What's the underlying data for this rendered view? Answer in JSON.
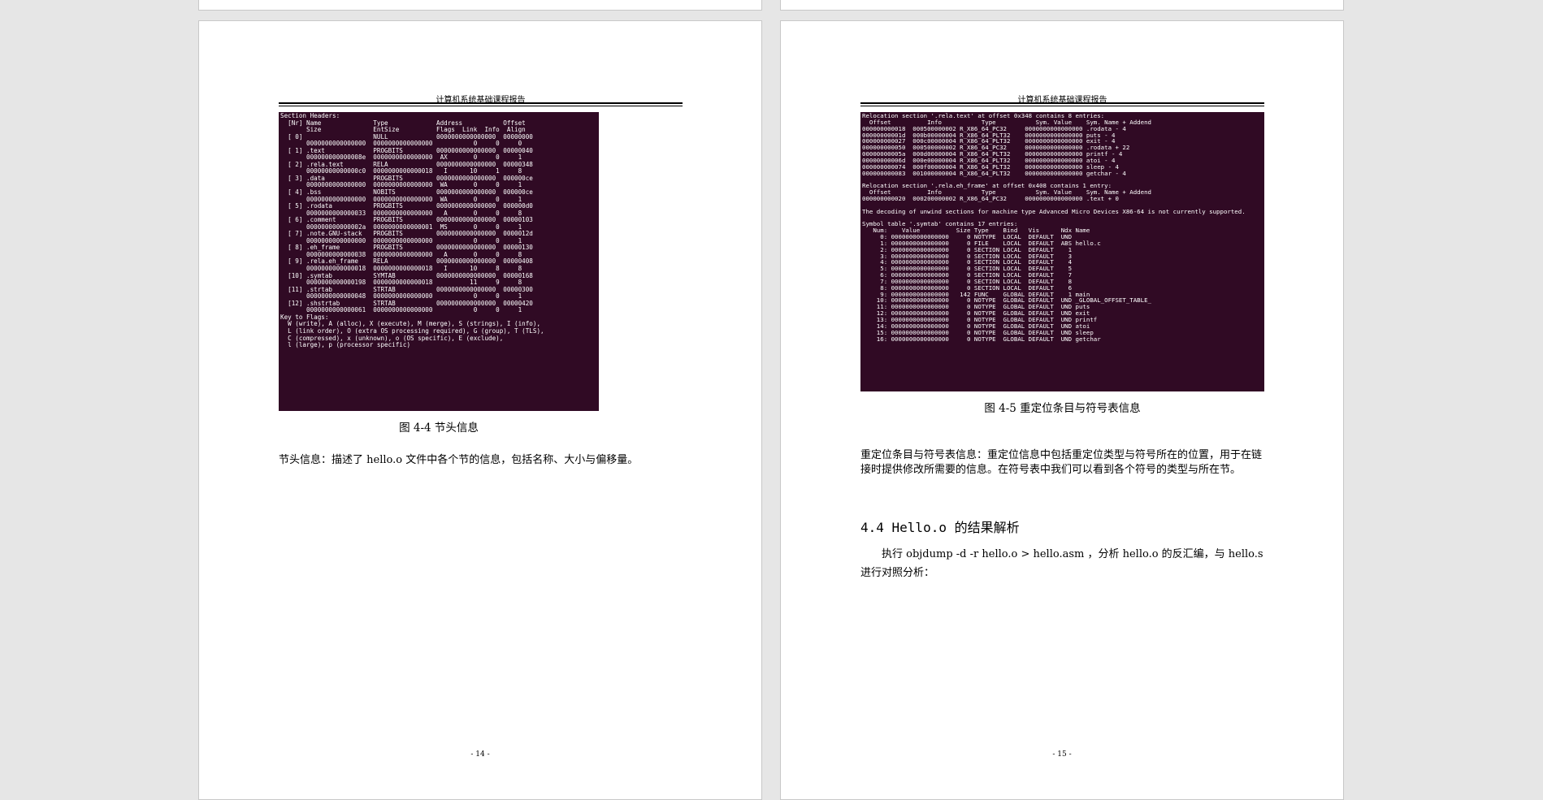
{
  "header_title": "计算机系统基础课程报告",
  "left_page": {
    "terminal_text": "Section Headers:\n  [Nr] Name              Type             Address           Offset\n       Size              EntSize          Flags  Link  Info  Align\n  [ 0]                   NULL             0000000000000000  00000000\n       0000000000000000  0000000000000000           0     0     0\n  [ 1] .text             PROGBITS         0000000000000000  00000040\n       000000000000008e  0000000000000000  AX       0     0     1\n  [ 2] .rela.text        RELA             0000000000000000  00000348\n       00000000000000c0  0000000000000018   I      10     1     8\n  [ 3] .data             PROGBITS         0000000000000000  000000ce\n       0000000000000000  0000000000000000  WA       0     0     1\n  [ 4] .bss              NOBITS           0000000000000000  000000ce\n       0000000000000000  0000000000000000  WA       0     0     1\n  [ 5] .rodata           PROGBITS         0000000000000000  000000d0\n       0000000000000033  0000000000000000   A       0     0     8\n  [ 6] .comment          PROGBITS         0000000000000000  00000103\n       000000000000002a  0000000000000001  MS       0     0     1\n  [ 7] .note.GNU-stack   PROGBITS         0000000000000000  0000012d\n       0000000000000000  0000000000000000           0     0     1\n  [ 8] .eh_frame         PROGBITS         0000000000000000  00000130\n       0000000000000038  0000000000000000   A       0     0     8\n  [ 9] .rela.eh_frame    RELA             0000000000000000  00000408\n       0000000000000018  0000000000000018   I      10     8     8\n  [10] .symtab           SYMTAB           0000000000000000  00000168\n       0000000000000198  0000000000000018          11     9     8\n  [11] .strtab           STRTAB           0000000000000000  00000300\n       0000000000000048  0000000000000000           0     0     1\n  [12] .shstrtab         STRTAB           0000000000000000  00000420\n       0000000000000061  0000000000000000           0     0     1\nKey to Flags:\n  W (write), A (alloc), X (execute), M (merge), S (strings), I (info),\n  L (link order), O (extra OS processing required), G (group), T (TLS),\n  C (compressed), x (unknown), o (OS specific), E (exclude),\n  l (large), p (processor specific)",
    "caption": "图 4-4 节头信息",
    "body_text": "节头信息：描述了 hello.o 文件中各个节的信息，包括名称、大小与偏移量。",
    "page_number": "- 14 -"
  },
  "right_page": {
    "terminal_text": "Relocation section '.rela.text' at offset 0x348 contains 8 entries:\n  Offset          Info           Type           Sym. Value    Sym. Name + Addend\n000000000018  000500000002 R_X86_64_PC32     0000000000000000 .rodata - 4\n00000000001d  000b00000004 R_X86_64_PLT32    0000000000000000 puts - 4\n000000000027  000c00000004 R_X86_64_PLT32    0000000000000000 exit - 4\n000000000050  000500000002 R_X86_64_PC32     0000000000000000 .rodata + 22\n00000000005a  000d00000004 R_X86_64_PLT32    0000000000000000 printf - 4\n00000000006d  000e00000004 R_X86_64_PLT32    0000000000000000 atoi - 4\n000000000074  000f00000004 R_X86_64_PLT32    0000000000000000 sleep - 4\n000000000083  001000000004 R_X86_64_PLT32    0000000000000000 getchar - 4\n\nRelocation section '.rela.eh_frame' at offset 0x408 contains 1 entry:\n  Offset          Info           Type           Sym. Value    Sym. Name + Addend\n000000000020  000200000002 R_X86_64_PC32     0000000000000000 .text + 0\n\nThe decoding of unwind sections for machine type Advanced Micro Devices X86-64 is not currently supported.\n\nSymbol table '.symtab' contains 17 entries:\n   Num:    Value          Size Type    Bind   Vis      Ndx Name\n     0: 0000000000000000     0 NOTYPE  LOCAL  DEFAULT  UND\n     1: 0000000000000000     0 FILE    LOCAL  DEFAULT  ABS hello.c\n     2: 0000000000000000     0 SECTION LOCAL  DEFAULT    1\n     3: 0000000000000000     0 SECTION LOCAL  DEFAULT    3\n     4: 0000000000000000     0 SECTION LOCAL  DEFAULT    4\n     5: 0000000000000000     0 SECTION LOCAL  DEFAULT    5\n     6: 0000000000000000     0 SECTION LOCAL  DEFAULT    7\n     7: 0000000000000000     0 SECTION LOCAL  DEFAULT    8\n     8: 0000000000000000     0 SECTION LOCAL  DEFAULT    6\n     9: 0000000000000000   142 FUNC    GLOBAL DEFAULT    1 main\n    10: 0000000000000000     0 NOTYPE  GLOBAL DEFAULT  UND _GLOBAL_OFFSET_TABLE_\n    11: 0000000000000000     0 NOTYPE  GLOBAL DEFAULT  UND puts\n    12: 0000000000000000     0 NOTYPE  GLOBAL DEFAULT  UND exit\n    13: 0000000000000000     0 NOTYPE  GLOBAL DEFAULT  UND printf\n    14: 0000000000000000     0 NOTYPE  GLOBAL DEFAULT  UND atoi\n    15: 0000000000000000     0 NOTYPE  GLOBAL DEFAULT  UND sleep\n    16: 0000000000000000     0 NOTYPE  GLOBAL DEFAULT  UND getchar",
    "caption": "图 4-5 重定位条目与符号表信息",
    "body_text": "重定位条目与符号表信息：重定位信息中包括重定位类型与符号所在的位置，用于在链接时提供修改所需要的信息。在符号表中我们可以看到各个符号的类型与所在节。",
    "section_heading": "4.4 Hello.o 的结果解析",
    "section_body": "执行 objdump -d -r hello.o > hello.asm ，分析 hello.o 的反汇编，与 hello.s 进行对照分析：",
    "page_number": "- 15 -"
  }
}
